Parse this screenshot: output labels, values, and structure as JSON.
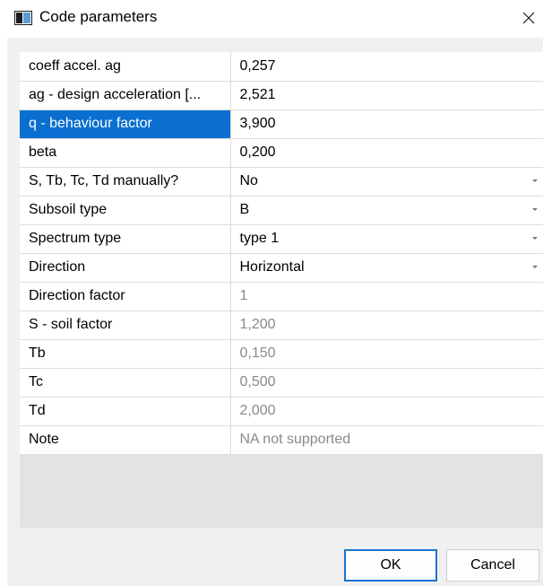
{
  "window": {
    "title": "Code parameters"
  },
  "grid": {
    "rows": [
      {
        "name": "coeff accel. ag",
        "value": "0,257",
        "readonly": false,
        "dropdown": false,
        "selected": false
      },
      {
        "name": "ag - design acceleration [...",
        "value": "2,521",
        "readonly": false,
        "dropdown": false,
        "selected": false
      },
      {
        "name": "q - behaviour factor",
        "value": "3,900",
        "readonly": false,
        "dropdown": false,
        "selected": true
      },
      {
        "name": "beta",
        "value": "0,200",
        "readonly": false,
        "dropdown": false,
        "selected": false
      },
      {
        "name": "S, Tb, Tc, Td manually?",
        "value": "No",
        "readonly": false,
        "dropdown": true,
        "selected": false
      },
      {
        "name": "Subsoil type",
        "value": "B",
        "readonly": false,
        "dropdown": true,
        "selected": false
      },
      {
        "name": "Spectrum type",
        "value": "type 1",
        "readonly": false,
        "dropdown": true,
        "selected": false
      },
      {
        "name": "Direction",
        "value": "Horizontal",
        "readonly": false,
        "dropdown": true,
        "selected": false
      },
      {
        "name": "Direction factor",
        "value": "1",
        "readonly": true,
        "dropdown": false,
        "selected": false
      },
      {
        "name": "S - soil factor",
        "value": "1,200",
        "readonly": true,
        "dropdown": false,
        "selected": false
      },
      {
        "name": "Tb",
        "value": "0,150",
        "readonly": true,
        "dropdown": false,
        "selected": false
      },
      {
        "name": "Tc",
        "value": "0,500",
        "readonly": true,
        "dropdown": false,
        "selected": false
      },
      {
        "name": "Td",
        "value": "2,000",
        "readonly": true,
        "dropdown": false,
        "selected": false
      },
      {
        "name": "Note",
        "value": "NA not supported",
        "readonly": true,
        "dropdown": false,
        "selected": false
      }
    ]
  },
  "buttons": {
    "ok_label": "OK",
    "cancel_label": "Cancel"
  },
  "colors": {
    "selection": "#0a6fd0",
    "ok_border": "#1e74d2",
    "readonly_text": "#8a8a8a",
    "panel_bg": "#f0f0f0"
  },
  "icons": {
    "app": "window-app-icon",
    "close": "close-icon",
    "dropdown": "chevron-down-icon"
  }
}
